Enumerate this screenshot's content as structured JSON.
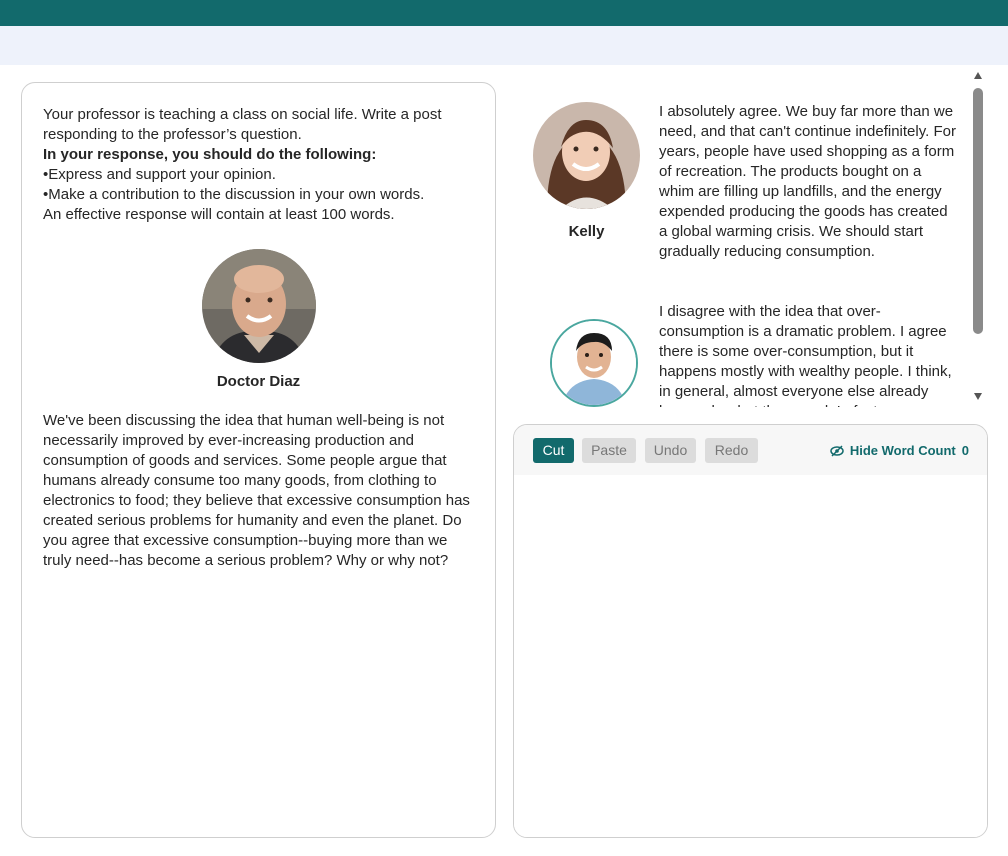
{
  "prompt": {
    "line1": "Your professor is teaching a class on social life. Write a post responding to the professor’s question.",
    "instructions_heading": "In your response, you should do the following:",
    "bullet1": "•Express and support your opinion.",
    "bullet2": "•Make a contribution to the discussion in your own words.",
    "requirement": "An effective response will contain at least 100 words."
  },
  "professor": {
    "name": "Doctor Diaz",
    "question": "We've been discussing the idea that human well-being is not necessarily improved by ever-increasing production and consumption of goods and services. Some people argue that humans already consume too many goods, from clothing to electronics to food; they believe that excessive consumption has created serious problems for humanity and even the planet. Do you agree that excessive consumption--buying more than we truly need--has become a serious problem? Why or why not?"
  },
  "students": [
    {
      "name": "Kelly",
      "post": "I absolutely agree. We buy far more than we need, and that can't continue indefinitely. For years, people have used shopping as a form of recreation. The products bought on a whim are filling up landfills, and the energy expended producing the goods has created a global warming crisis. We should start gradually reducing consumption."
    },
    {
      "name": "",
      "post": "I disagree with the idea that over-consumption is a dramatic problem. I agree there is some over-consumption, but it happens mostly with wealthy people. I think, in general, almost everyone else already buys only what they need. In fact,"
    }
  ],
  "toolbar": {
    "cut": "Cut",
    "paste": "Paste",
    "undo": "Undo",
    "redo": "Redo",
    "word_count_label": "Hide Word Count",
    "word_count_value": "0"
  },
  "editor": {
    "value": ""
  },
  "colors": {
    "brand": "#126a6c",
    "header_sub": "#eef2fb"
  },
  "icons": {
    "word_count_toggle": "eye-slash-icon"
  }
}
